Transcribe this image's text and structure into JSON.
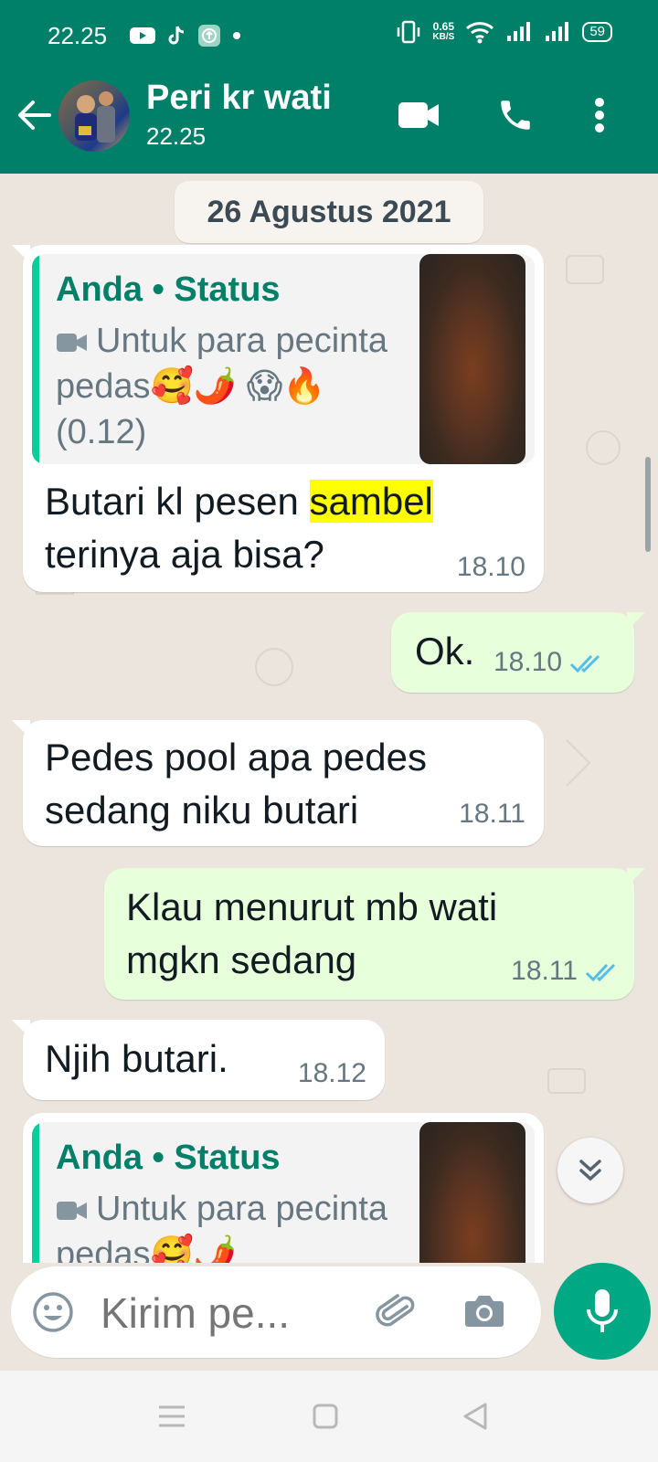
{
  "status_bar": {
    "time": "22.25",
    "net_speed": "0.65",
    "net_unit": "KB/S",
    "battery": "59"
  },
  "header": {
    "contact_name": "Peri kr wati",
    "subtitle": "22.25"
  },
  "chat": {
    "date_chip": "26 Agustus 2021",
    "messages": [
      {
        "direction": "in",
        "quote": {
          "header": "Anda • Status",
          "text": "Untuk para pecinta pedas🥰🌶️ 😱🔥 (0.12)"
        },
        "text_before": "Butari kl pesen ",
        "highlight": "sambel",
        "text_after": " terinya aja bisa?",
        "time": "18.10"
      },
      {
        "direction": "out",
        "text": "Ok.",
        "time": "18.10",
        "read": true
      },
      {
        "direction": "in",
        "text": "Pedes pool apa pedes sedang niku butari",
        "time": "18.11"
      },
      {
        "direction": "out",
        "text": "Klau menurut mb wati mgkn sedang",
        "time": "18.11",
        "read": true
      },
      {
        "direction": "in",
        "text": "Njih butari.",
        "time": "18.12"
      },
      {
        "direction": "in",
        "quote": {
          "header": "Anda • Status",
          "text": "Untuk para pecinta pedas🥰🌶️"
        }
      }
    ]
  },
  "composer": {
    "placeholder": "Kirim pe..."
  },
  "colors": {
    "header_bg": "#008069",
    "accent": "#00a884",
    "outgoing_bubble": "#e7ffdb",
    "chat_bg": "#ece5dd",
    "read_ticks": "#53bdeb",
    "highlight": "#ffff00"
  },
  "icons": {
    "header": [
      "back-arrow-icon",
      "video-call-icon",
      "phone-call-icon",
      "more-options-icon"
    ],
    "composer": [
      "emoji-icon",
      "attach-icon",
      "camera-icon",
      "mic-icon"
    ],
    "nav": [
      "recents-icon",
      "home-icon",
      "back-icon"
    ]
  }
}
